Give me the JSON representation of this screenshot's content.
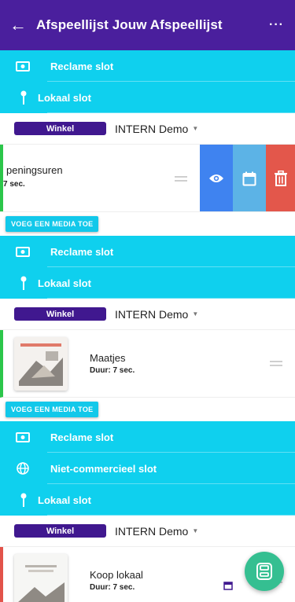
{
  "appbar": {
    "back_icon": "arrow-left-icon",
    "title": "Afspeellijst Jouw Afspeellijst",
    "more_label": "···"
  },
  "groups": [
    {
      "slots": [
        {
          "icon": "money-icon",
          "label": "Reclame slot"
        },
        {
          "icon": "pin-icon",
          "label": "Lokaal slot"
        }
      ],
      "store_badge": "Winkel",
      "store_select": "INTERN Demo",
      "media": [
        {
          "name": "peningsuren",
          "duration": "7 sec.",
          "swiped": true,
          "actions": [
            "eye-icon",
            "calendar-icon",
            "trash-icon"
          ]
        }
      ],
      "add_button": "VOEG EEN MEDIA TOE"
    },
    {
      "slots": [
        {
          "icon": "money-icon",
          "label": "Reclame slot"
        },
        {
          "icon": "pin-icon",
          "label": "Lokaal slot"
        }
      ],
      "store_badge": "Winkel",
      "store_select": "INTERN Demo",
      "media": [
        {
          "name": "Maatjes",
          "duration": "Duur: 7 sec."
        }
      ],
      "add_button": "VOEG EEN MEDIA TOE"
    },
    {
      "slots": [
        {
          "icon": "money-icon",
          "label": "Reclame slot"
        },
        {
          "icon": "globe-icon",
          "label": "Niet-commercieel slot"
        },
        {
          "icon": "pin-icon",
          "label": "Lokaal slot"
        }
      ],
      "store_badge": "Winkel",
      "store_select": "INTERN Demo",
      "media": [
        {
          "name": "Koop lokaal",
          "duration": "Duur: 7 sec."
        }
      ]
    }
  ],
  "fab": {
    "icon": "save-icon"
  },
  "colors": {
    "appbar": "#4a1f9d",
    "slot": "#0fd0ee",
    "badge": "#40188f",
    "fab": "#35bf91"
  }
}
